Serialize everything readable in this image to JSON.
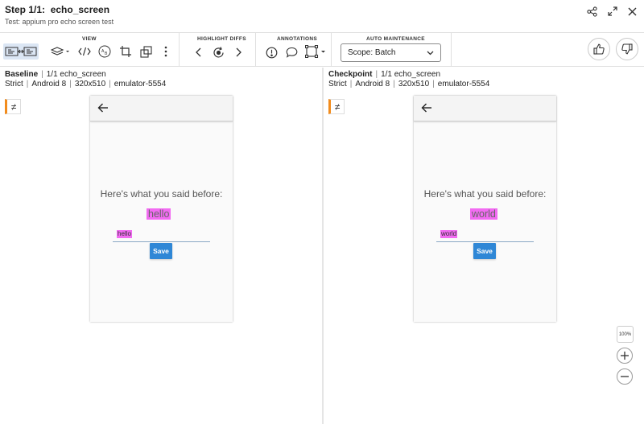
{
  "header": {
    "step": "Step 1/1:",
    "step_name": "echo_screen",
    "test_label": "Test: appium pro echo screen test"
  },
  "toolbar": {
    "view_label": "VIEW",
    "highlight_label": "HIGHLIGHT DIFFS",
    "annotations_label": "ANNOTATIONS",
    "auto_label": "AUTO MAINTENANCE",
    "scope_value": "Scope: Batch"
  },
  "baseline": {
    "title": "Baseline",
    "step": "1/1 echo_screen",
    "mode": "Strict",
    "os": "Android 8",
    "size": "320x510",
    "device": "emulator-5554",
    "diff_marker": "≠",
    "said_text": "Here's what you said before:",
    "echo": "hello",
    "field_value": "hello",
    "save_label": "Save"
  },
  "checkpoint": {
    "title": "Checkpoint",
    "step": "1/1 echo_screen",
    "mode": "Strict",
    "os": "Android 8",
    "size": "320x510",
    "device": "emulator-5554",
    "diff_marker": "≠",
    "said_text": "Here's what you said before:",
    "echo": "world",
    "field_value": "world",
    "save_label": "Save"
  },
  "zoom": {
    "reset_label": "100%"
  },
  "colors": {
    "diff_highlight": "#f26bf2",
    "accent": "#2f87d6",
    "diff_marker": "#f28c1d"
  }
}
